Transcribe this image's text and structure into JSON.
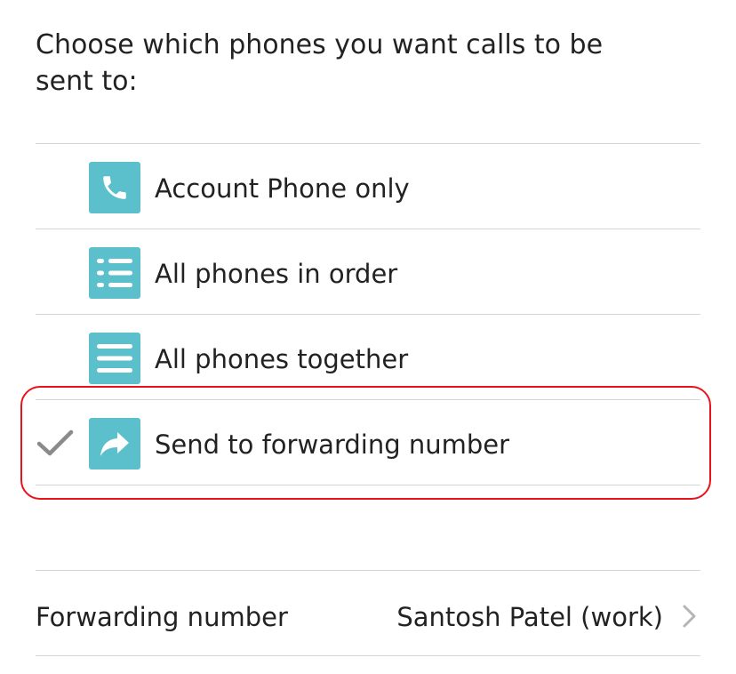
{
  "heading": "Choose which phones you want calls to be sent to:",
  "options": [
    {
      "label": "Account Phone only",
      "icon": "phone-icon",
      "selected": false
    },
    {
      "label": "All phones in order",
      "icon": "list-order-icon",
      "selected": false
    },
    {
      "label": "All phones together",
      "icon": "list-together-icon",
      "selected": false
    },
    {
      "label": "Send to forwarding number",
      "icon": "forward-arrow-icon",
      "selected": true
    }
  ],
  "forwarding": {
    "label": "Forwarding number",
    "value": "Santosh Patel (work)"
  },
  "colors": {
    "icon_bg": "#5bc0cc",
    "highlight": "#e8141c",
    "divider": "#d4d4d4",
    "check": "#8a8a8a"
  }
}
